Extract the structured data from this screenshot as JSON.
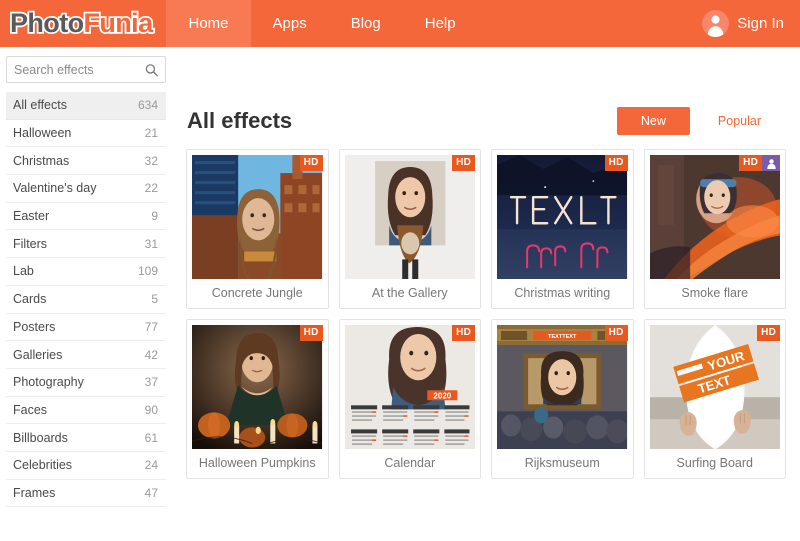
{
  "header": {
    "logo_first": "Photo",
    "logo_second": "Funia",
    "nav": [
      {
        "label": "Home",
        "active": true
      },
      {
        "label": "Apps",
        "active": false
      },
      {
        "label": "Blog",
        "active": false
      },
      {
        "label": "Help",
        "active": false
      }
    ],
    "signin_label": "Sign In",
    "avatar_icon": "user-avatar-icon",
    "brand_color": "#f4673b"
  },
  "sidebar": {
    "search_placeholder": "Search effects",
    "search_value": "",
    "search_icon": "search-icon",
    "categories": [
      {
        "label": "All effects",
        "count": "634",
        "active": true
      },
      {
        "label": "Halloween",
        "count": "21",
        "active": false
      },
      {
        "label": "Christmas",
        "count": "32",
        "active": false
      },
      {
        "label": "Valentine's day",
        "count": "22",
        "active": false
      },
      {
        "label": "Easter",
        "count": "9",
        "active": false
      },
      {
        "label": "Filters",
        "count": "31",
        "active": false
      },
      {
        "label": "Lab",
        "count": "109",
        "active": false
      },
      {
        "label": "Cards",
        "count": "5",
        "active": false
      },
      {
        "label": "Posters",
        "count": "77",
        "active": false
      },
      {
        "label": "Galleries",
        "count": "42",
        "active": false
      },
      {
        "label": "Photography",
        "count": "37",
        "active": false
      },
      {
        "label": "Faces",
        "count": "90",
        "active": false
      },
      {
        "label": "Billboards",
        "count": "61",
        "active": false
      },
      {
        "label": "Celebrities",
        "count": "24",
        "active": false
      },
      {
        "label": "Frames",
        "count": "47",
        "active": false
      }
    ]
  },
  "main": {
    "title": "All effects",
    "sort_tabs": [
      {
        "label": "New",
        "active": true
      },
      {
        "label": "Popular",
        "active": false
      }
    ],
    "badge_hd_label": "HD",
    "badge_person_icon": "person-badge-icon",
    "cards": [
      {
        "title": "Concrete Jungle",
        "hd": true,
        "person": false,
        "art": "concrete-jungle"
      },
      {
        "title": "At the Gallery",
        "hd": true,
        "person": false,
        "art": "at-the-gallery"
      },
      {
        "title": "Christmas writing",
        "hd": true,
        "person": false,
        "art": "christmas-writing",
        "overlay_text": "TEXT"
      },
      {
        "title": "Smoke flare",
        "hd": true,
        "person": true,
        "art": "smoke-flare"
      },
      {
        "title": "Halloween Pumpkins",
        "hd": true,
        "person": false,
        "art": "halloween-pumpkins"
      },
      {
        "title": "Calendar",
        "hd": true,
        "person": false,
        "art": "calendar",
        "overlay_text": "2020"
      },
      {
        "title": "Rijksmuseum",
        "hd": true,
        "person": false,
        "art": "rijksmuseum",
        "overlay_text": "TEXTTEXT"
      },
      {
        "title": "Surfing Board",
        "hd": true,
        "person": false,
        "art": "surfing-board",
        "overlay_text_1": "YOUR",
        "overlay_text_2": "TEXT"
      }
    ]
  }
}
